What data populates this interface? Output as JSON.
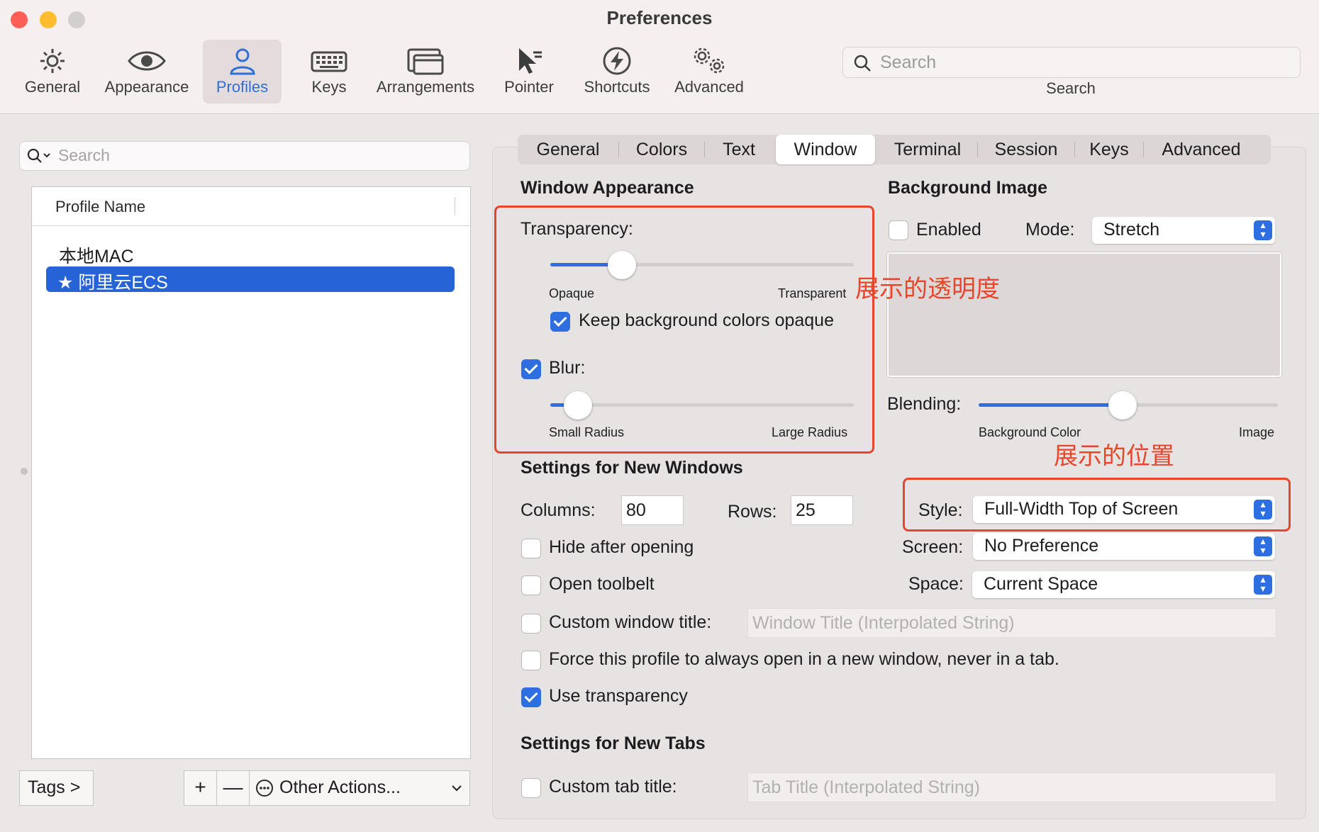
{
  "window": {
    "title": "Preferences"
  },
  "toolbar": {
    "items": [
      {
        "label": "General",
        "icon": "gear-icon"
      },
      {
        "label": "Appearance",
        "icon": "eye-icon"
      },
      {
        "label": "Profiles",
        "icon": "person-icon",
        "active": true
      },
      {
        "label": "Keys",
        "icon": "keyboard-icon"
      },
      {
        "label": "Arrangements",
        "icon": "windows-icon"
      },
      {
        "label": "Pointer",
        "icon": "pointer-icon"
      },
      {
        "label": "Shortcuts",
        "icon": "bolt-icon"
      },
      {
        "label": "Advanced",
        "icon": "gears-icon"
      }
    ],
    "search_placeholder": "Search",
    "search_label": "Search"
  },
  "profiles": {
    "search_placeholder": "Search",
    "column_header": "Profile Name",
    "rows": [
      "本地MAC",
      "★ 阿里云ECS"
    ],
    "selected_index": 1,
    "tags_button": "Tags >",
    "plus": "+",
    "minus": "—",
    "other_actions": "Other Actions..."
  },
  "tabs": [
    "General",
    "Colors",
    "Text",
    "Window",
    "Terminal",
    "Session",
    "Keys",
    "Advanced"
  ],
  "selected_tab": "Window",
  "window_appearance": {
    "heading": "Window Appearance",
    "transparency_label": "Transparency:",
    "transparency_value": 0.21,
    "transparency_min": "Opaque",
    "transparency_max": "Transparent",
    "keep_bg_opaque": {
      "label": "Keep background colors opaque",
      "checked": true
    },
    "blur": {
      "label": "Blur:",
      "checked": true
    },
    "blur_value": 0.05,
    "blur_min": "Small Radius",
    "blur_max": "Large Radius"
  },
  "background_image": {
    "heading": "Background Image",
    "enabled": {
      "label": "Enabled",
      "checked": false
    },
    "mode_label": "Mode:",
    "mode_value": "Stretch",
    "blending_label": "Blending:",
    "blending_value": 0.48,
    "blending_min": "Background Color",
    "blending_max": "Image"
  },
  "new_windows": {
    "heading": "Settings for New Windows",
    "columns_label": "Columns:",
    "columns_value": "80",
    "rows_label": "Rows:",
    "rows_value": "25",
    "style_label": "Style:",
    "style_value": "Full-Width Top of Screen",
    "screen_label": "Screen:",
    "screen_value": "No Preference",
    "space_label": "Space:",
    "space_value": "Current Space",
    "hide_after_opening": {
      "label": "Hide after opening",
      "checked": false
    },
    "open_toolbelt": {
      "label": "Open toolbelt",
      "checked": false
    },
    "custom_window_title": {
      "label": "Custom window title:",
      "checked": false,
      "placeholder": "Window Title (Interpolated String)"
    },
    "force_new_window": {
      "label": "Force this profile to always open in a new window, never in a tab.",
      "checked": false
    },
    "use_transparency": {
      "label": "Use transparency",
      "checked": true
    }
  },
  "new_tabs": {
    "heading": "Settings for New Tabs",
    "custom_tab_title": {
      "label": "Custom tab title:",
      "checked": false,
      "placeholder": "Tab Title (Interpolated String)"
    }
  },
  "annotations": {
    "transparency_note": "展示的透明度",
    "position_note": "展示的位置",
    "color": "#e8462b"
  },
  "colors": {
    "accent": "#2d6fe0",
    "selection": "#2563d6"
  }
}
